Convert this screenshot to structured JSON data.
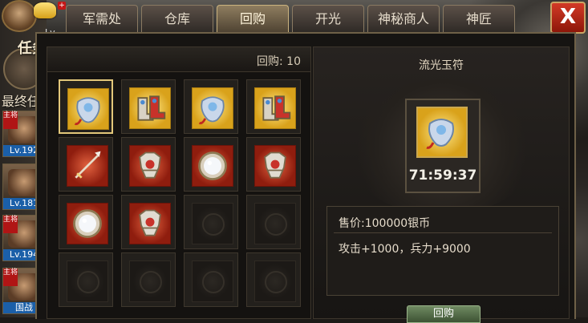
{
  "left": {
    "level_prefix": "Lv",
    "task_label": "任务",
    "final_task": "最终任",
    "heroes": [
      {
        "tag": "主将",
        "level": "Lv.192"
      },
      {
        "tag": "",
        "level": "Lv.181"
      },
      {
        "tag": "主将",
        "level": "Lv.194"
      },
      {
        "tag": "主将",
        "level": "国战"
      }
    ]
  },
  "tabs": [
    {
      "label": "军需处"
    },
    {
      "label": "仓库"
    },
    {
      "label": "回购"
    },
    {
      "label": "开光"
    },
    {
      "label": "神秘商人"
    },
    {
      "label": "神匠"
    }
  ],
  "close_label": "X",
  "inventory": {
    "buyback_count": "回购: 10",
    "slots": [
      {
        "item": "amulet",
        "rarity": "gold"
      },
      {
        "item": "boots",
        "rarity": "gold"
      },
      {
        "item": "amulet",
        "rarity": "gold"
      },
      {
        "item": "boots",
        "rarity": "gold"
      },
      {
        "item": "spear",
        "rarity": "red"
      },
      {
        "item": "armor",
        "rarity": "red"
      },
      {
        "item": "mirror",
        "rarity": "red"
      },
      {
        "item": "armor",
        "rarity": "red"
      },
      {
        "item": "mirror",
        "rarity": "red"
      },
      {
        "item": "armor",
        "rarity": "red"
      },
      {
        "item": "",
        "rarity": ""
      },
      {
        "item": "",
        "rarity": ""
      },
      {
        "item": "",
        "rarity": ""
      },
      {
        "item": "",
        "rarity": ""
      },
      {
        "item": "",
        "rarity": ""
      },
      {
        "item": "",
        "rarity": ""
      }
    ]
  },
  "detail": {
    "title": "流光玉符",
    "timer": "71:59:37",
    "price": "售价:100000银币",
    "stats": "攻击+1000，兵力+9000",
    "buy_label": "回购"
  },
  "colors": {
    "gold": "#d9a21b",
    "red": "#8f1d0e",
    "accent": "#caa565",
    "close": "#d33a26"
  }
}
